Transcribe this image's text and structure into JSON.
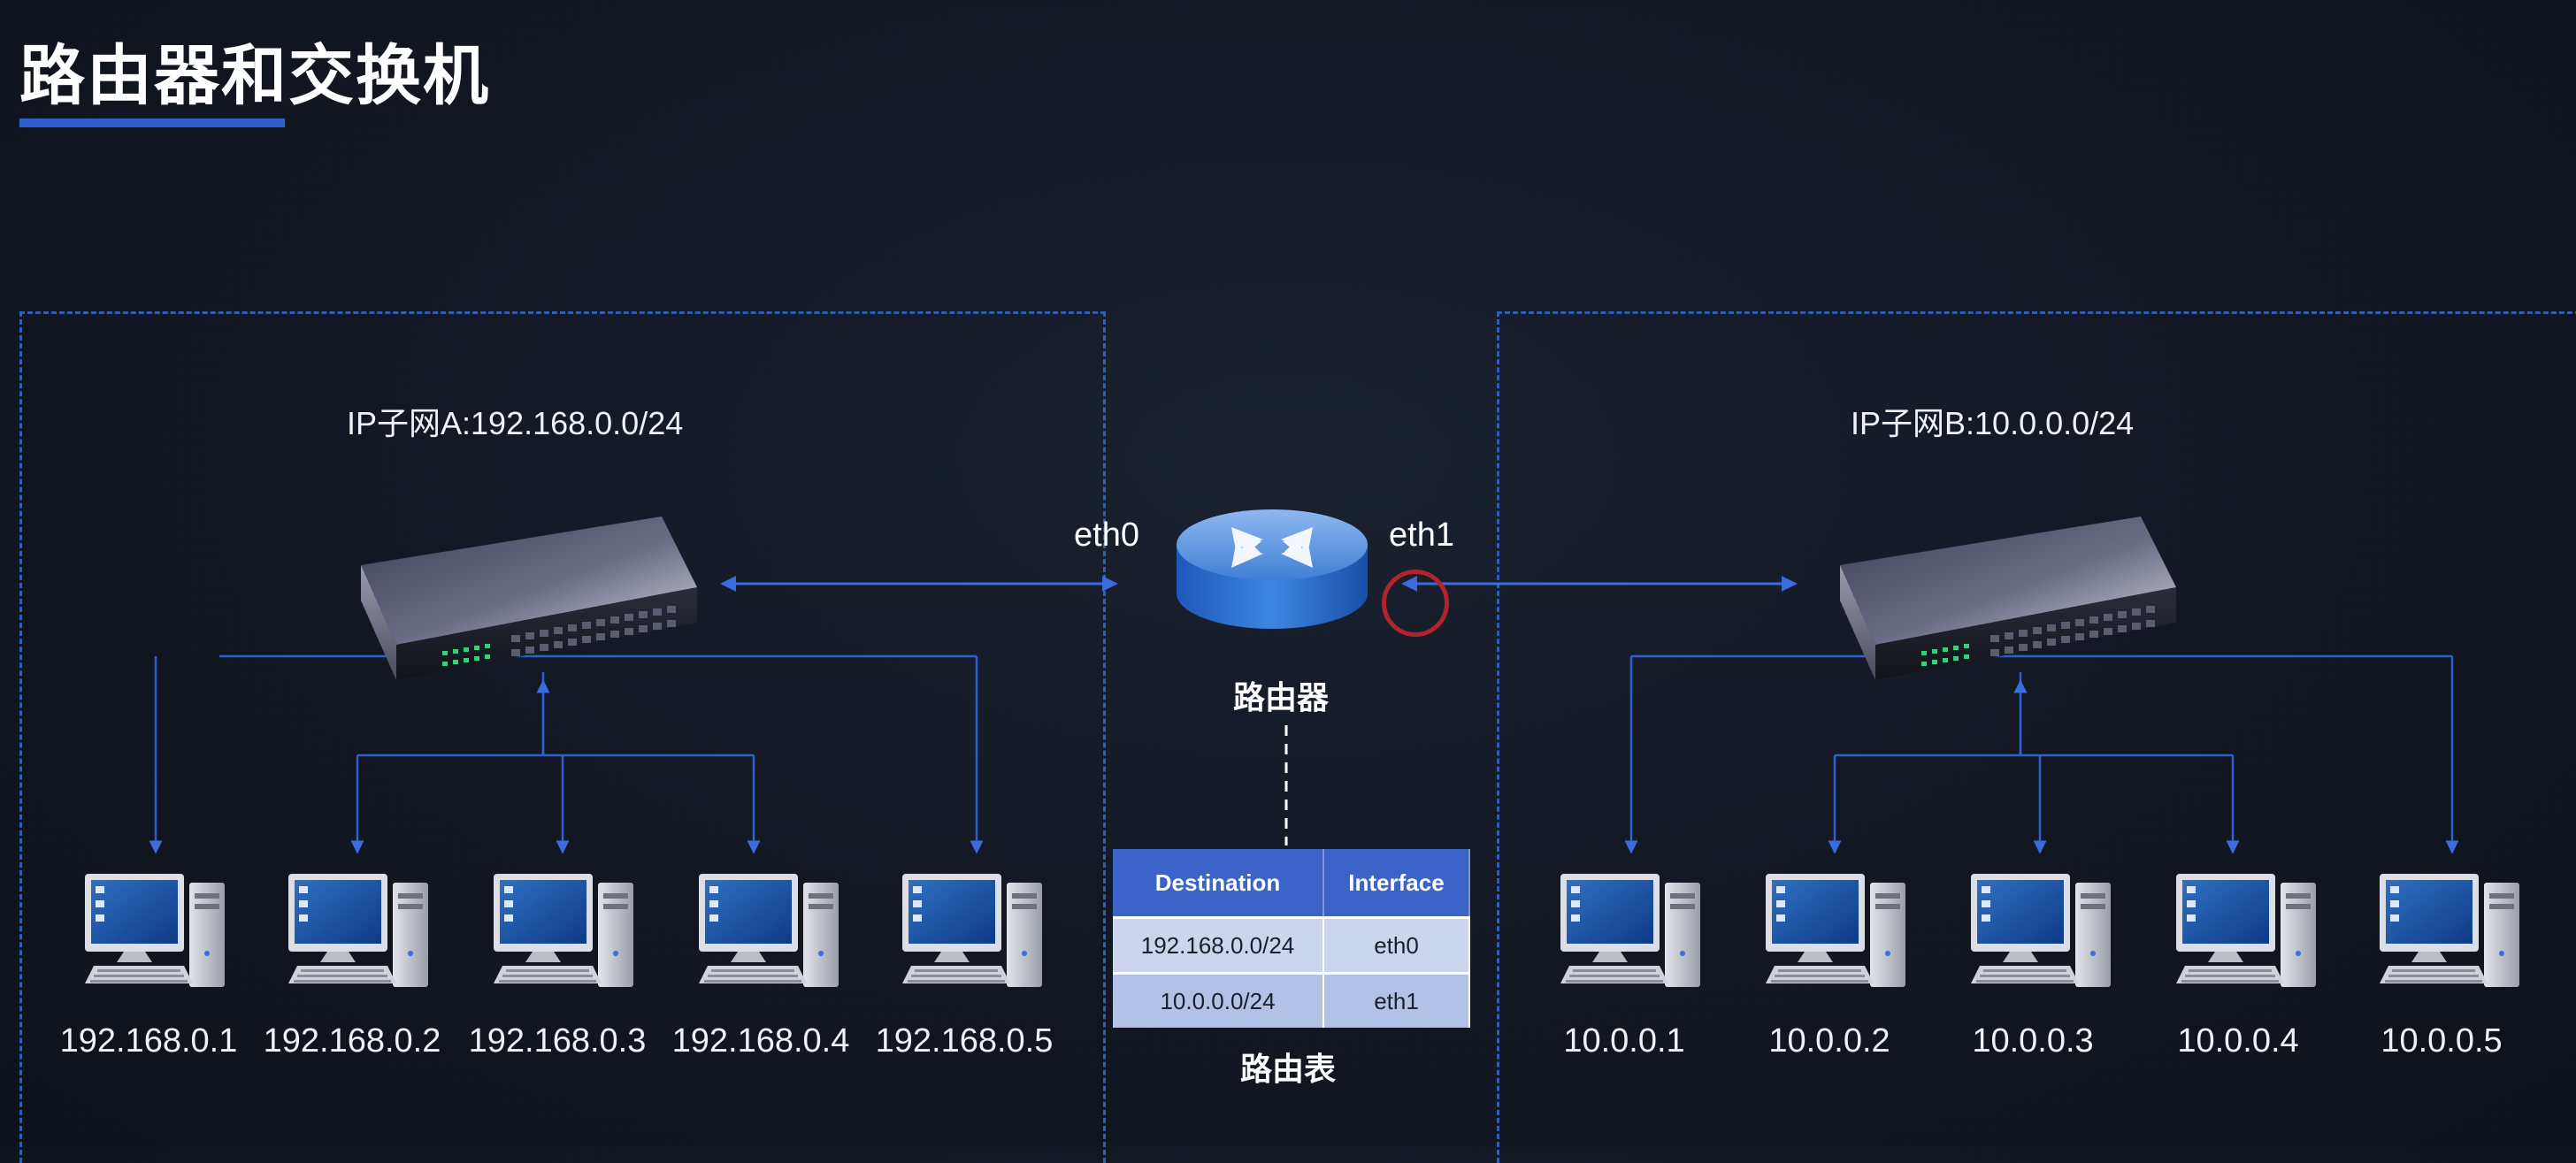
{
  "title": "路由器和交换机",
  "subnet_a": {
    "label": "IP子网A:192.168.0.0/24",
    "hosts": [
      "192.168.0.1",
      "192.168.0.2",
      "192.168.0.3",
      "192.168.0.4",
      "192.168.0.5"
    ]
  },
  "subnet_b": {
    "label": "IP子网B:10.0.0.0/24",
    "hosts": [
      "10.0.0.1",
      "10.0.0.2",
      "10.0.0.3",
      "10.0.0.4",
      "10.0.0.5"
    ]
  },
  "router": {
    "label": "路由器",
    "port_left": "eth0",
    "port_right": "eth1"
  },
  "routing_table": {
    "caption": "路由表",
    "headers": [
      "Destination",
      "Interface"
    ],
    "rows": [
      [
        "192.168.0.0/24",
        "eth0"
      ],
      [
        "10.0.0.0/24",
        "eth1"
      ]
    ]
  },
  "colors": {
    "link": "#2f5fd0",
    "dashed_border": "#2d5fb5",
    "highlight_circle": "#b0242c",
    "table_header": "#3b63c8"
  },
  "icons": {
    "switch": "network-switch-icon",
    "router": "router-icon",
    "computer": "desktop-computer-icon"
  }
}
